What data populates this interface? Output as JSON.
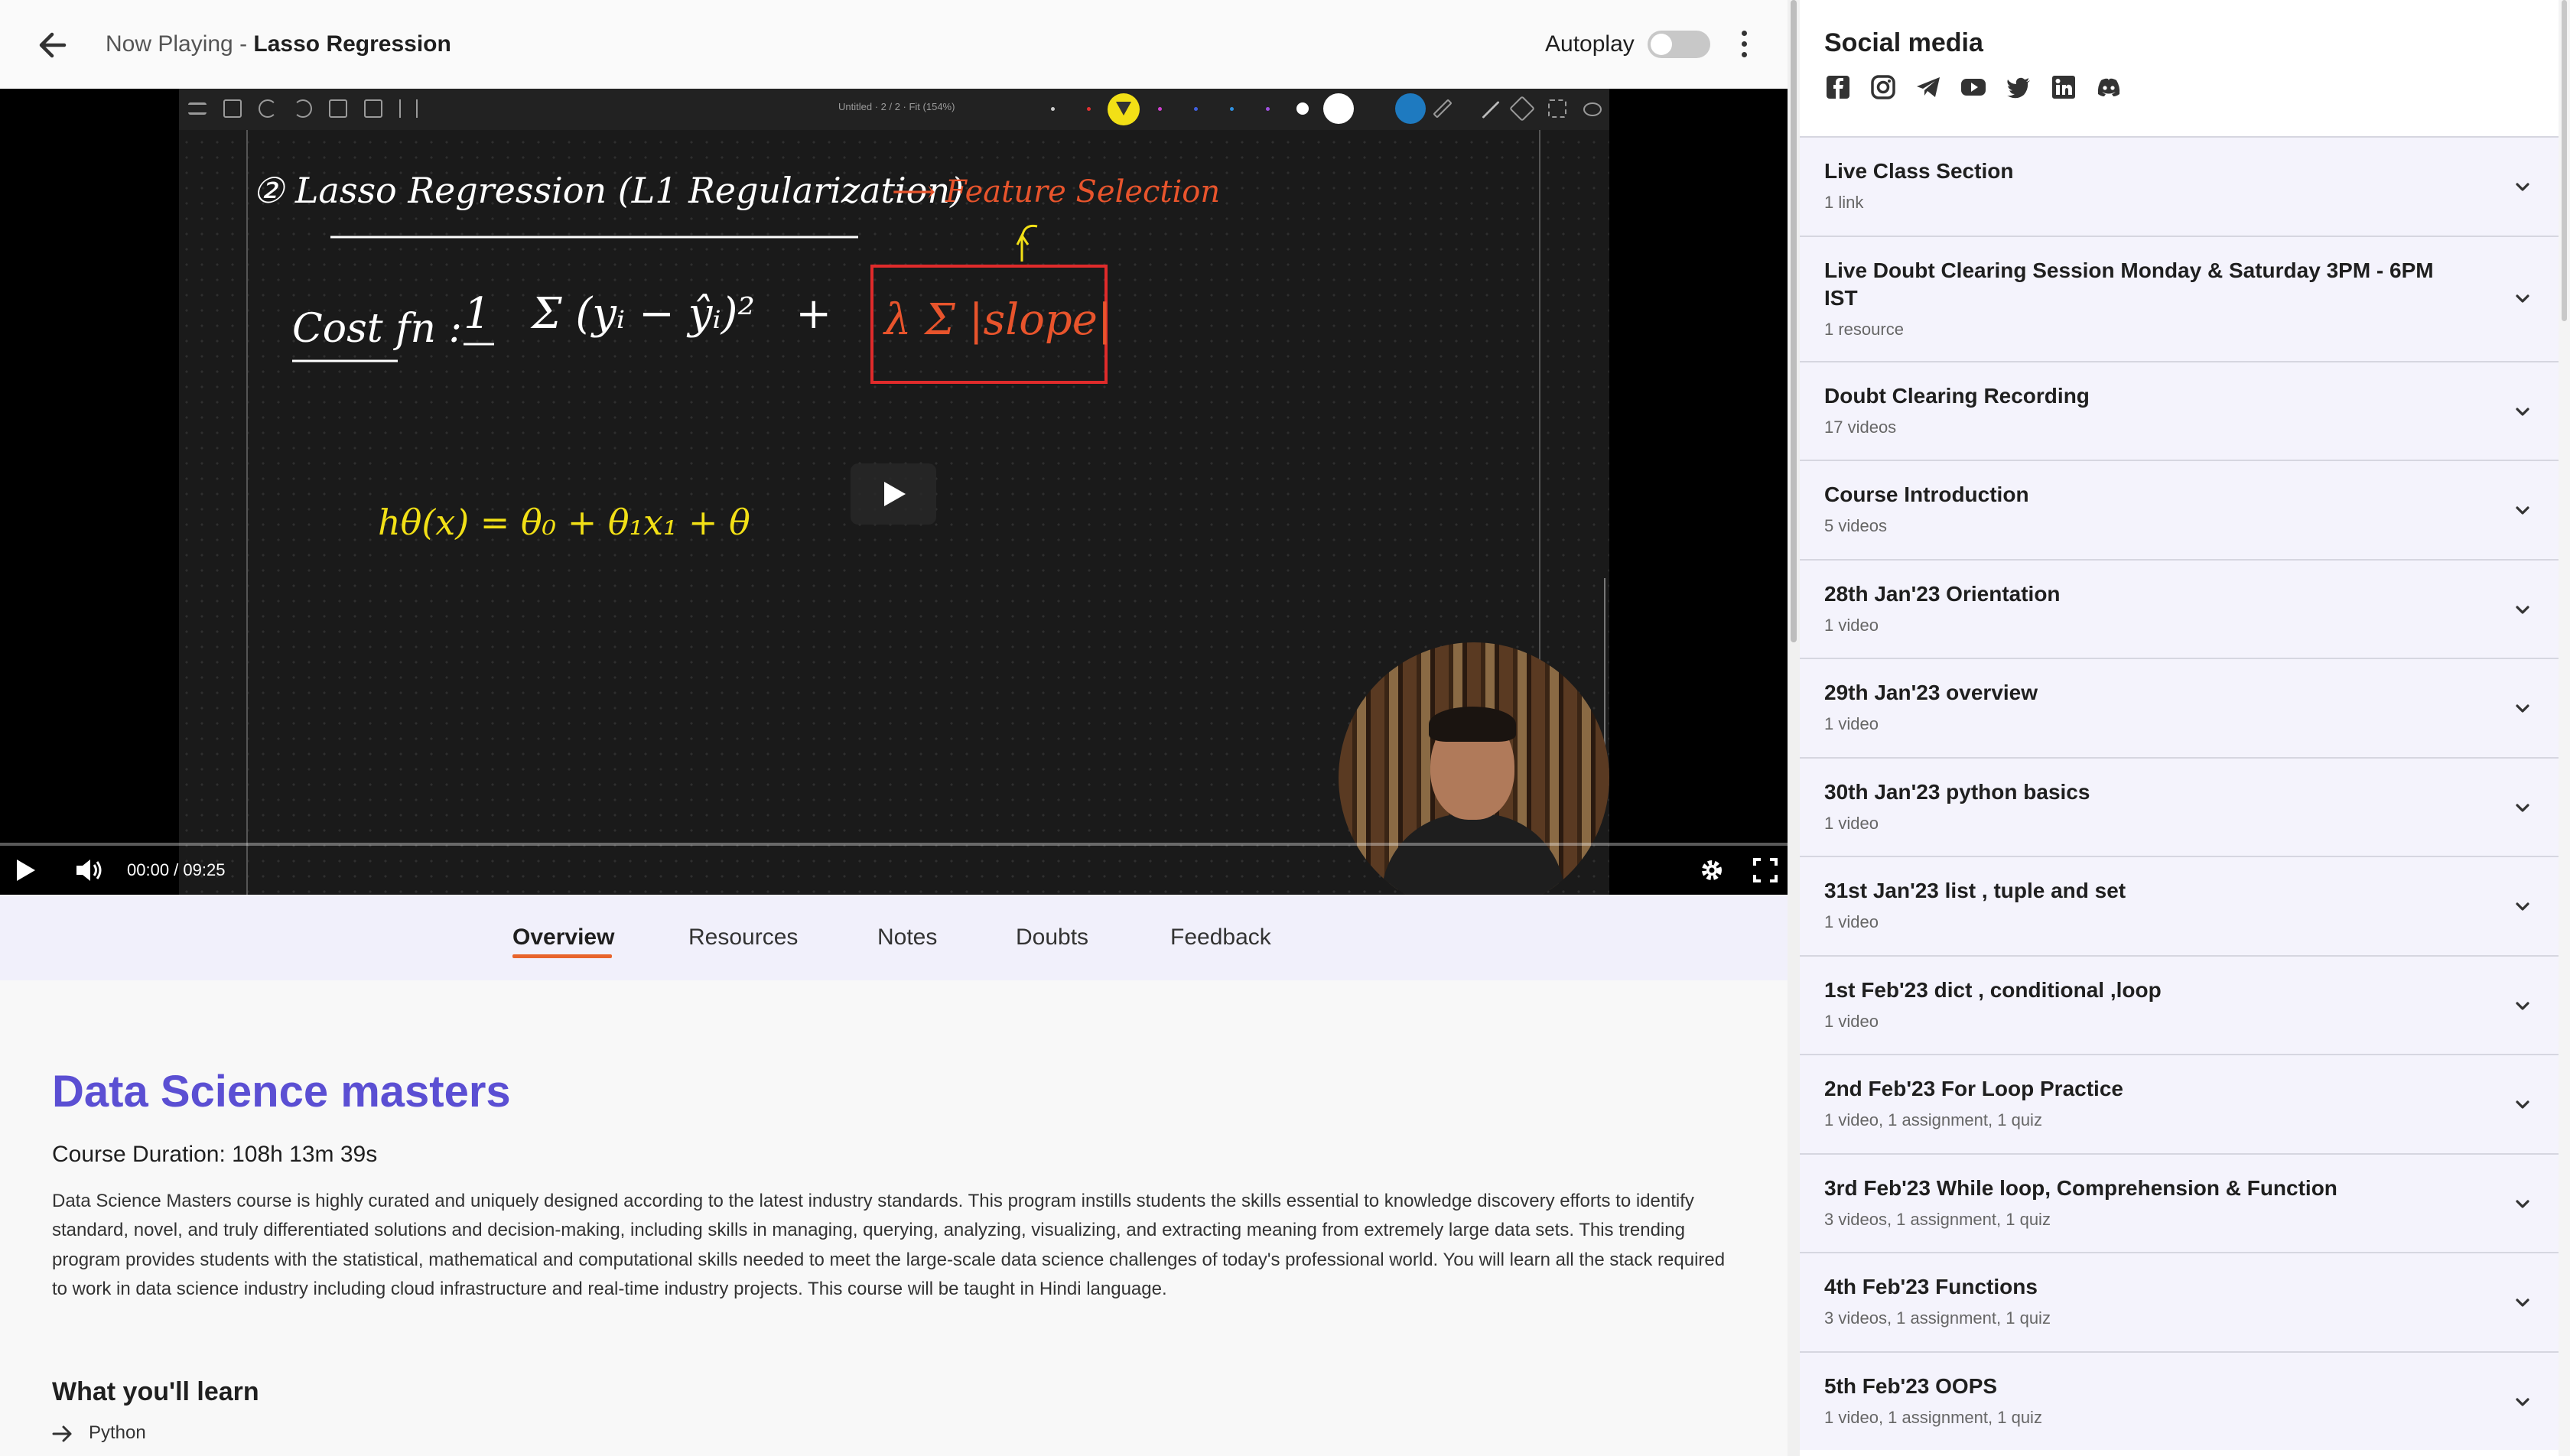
{
  "header": {
    "now_playing_prefix": "Now Playing - ",
    "lecture_title": "Lasso Regression",
    "autoplay_label": "Autoplay",
    "autoplay_on": false
  },
  "video": {
    "board_title": "Untitled  ·  2 / 2  ·  Fit (154%)",
    "heading": "② Lasso Regression (L1 Regularization)",
    "annotation": "⟶ Feature Selection",
    "cost_fn": "Cost fn :",
    "hypothesis": "hθ(x) = θ₀ + θ₁x₁ + θ",
    "time": "00:00 / 09:25",
    "progress": 0
  },
  "tabs": [
    {
      "label": "Overview",
      "active": true
    },
    {
      "label": "Resources",
      "active": false
    },
    {
      "label": "Notes",
      "active": false
    },
    {
      "label": "Doubts",
      "active": false
    },
    {
      "label": "Feedback",
      "active": false
    }
  ],
  "overview": {
    "course_title": "Data Science masters",
    "duration": "Course Duration: 108h 13m 39s",
    "description": "Data Science Masters course is highly curated and uniquely designed according to the latest industry standards. This program instills students the skills essential to knowledge discovery efforts to identify standard, novel, and truly differentiated solutions and decision-making, including skills in managing, querying, analyzing, visualizing, and extracting meaning from extremely large data sets. This trending program provides students with the statistical, mathematical and computational skills needed to meet the large-scale data science challenges of today's professional world. You will learn all the stack required to work in data science industry including cloud infrastructure and real-time industry projects. This course will be taught in Hindi language.",
    "learn_heading": "What you'll learn",
    "learn_items": [
      "Python"
    ]
  },
  "sidebar": {
    "social_title": "Social media",
    "social_icons": [
      "facebook-icon",
      "instagram-icon",
      "telegram-icon",
      "youtube-icon",
      "twitter-icon",
      "linkedin-icon",
      "discord-icon"
    ],
    "sections": [
      {
        "title": "Live Class Section",
        "sub": "1 link"
      },
      {
        "title": "Live Doubt Clearing Session Monday & Saturday 3PM - 6PM IST",
        "sub": "1 resource"
      },
      {
        "title": "Doubt Clearing Recording",
        "sub": "17 videos"
      },
      {
        "title": "Course Introduction",
        "sub": "5 videos"
      },
      {
        "title": "28th Jan'23 Orientation",
        "sub": "1 video"
      },
      {
        "title": "29th Jan'23 overview",
        "sub": "1 video"
      },
      {
        "title": "30th Jan'23 python basics",
        "sub": "1 video"
      },
      {
        "title": "31st Jan'23 list , tuple and set",
        "sub": "1 video"
      },
      {
        "title": "1st Feb'23 dict , conditional ,loop",
        "sub": "1 video"
      },
      {
        "title": "2nd Feb'23 For Loop Practice",
        "sub": "1 video, 1 assignment, 1 quiz"
      },
      {
        "title": "3rd Feb'23 While loop, Comprehension & Function",
        "sub": "3 videos, 1 assignment, 1 quiz"
      },
      {
        "title": "4th Feb'23 Functions",
        "sub": "3 videos, 1 assignment, 1 quiz"
      },
      {
        "title": "5th Feb'23 OOPS",
        "sub": "1 video, 1 assignment, 1 quiz"
      }
    ]
  },
  "colors": {
    "accent_purple": "#5b4fd3",
    "tab_underline": "#e8642c",
    "section_bg": "#f4f3fc"
  }
}
